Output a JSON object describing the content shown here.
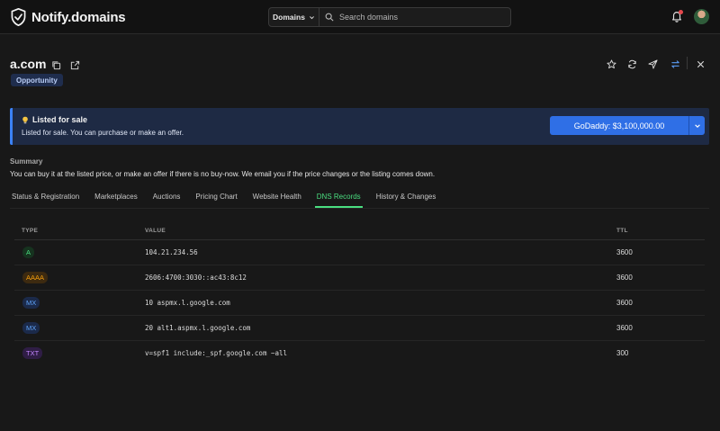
{
  "app": {
    "name": "Notify.domains"
  },
  "search": {
    "scope": "Domains",
    "placeholder": "Search domains"
  },
  "domain": {
    "name": "a.com",
    "badge": "Opportunity"
  },
  "banner": {
    "icon": "lightbulb-icon",
    "title": "Listed for sale",
    "text": "Listed for sale. You can purchase or make an offer.",
    "button_label": "GoDaddy: $3,100,000.00"
  },
  "summary": {
    "label": "Summary",
    "text": "You can buy it at the listed price, or make an offer if there is no buy-now. We email you if the price changes or the listing comes down."
  },
  "tabs": [
    {
      "label": "Status & Registration",
      "active": false
    },
    {
      "label": "Marketplaces",
      "active": false
    },
    {
      "label": "Auctions",
      "active": false
    },
    {
      "label": "Pricing Chart",
      "active": false
    },
    {
      "label": "Website Health",
      "active": false
    },
    {
      "label": "DNS Records",
      "active": true
    },
    {
      "label": "History & Changes",
      "active": false
    }
  ],
  "dns": {
    "headers": {
      "type": "TYPE",
      "value": "VALUE",
      "ttl": "TTL"
    },
    "rows": [
      {
        "type": "A",
        "value": "104.21.234.56",
        "ttl": "3600"
      },
      {
        "type": "AAAA",
        "value": "2606:4700:3030::ac43:8c12",
        "ttl": "3600"
      },
      {
        "type": "MX",
        "value": "10 aspmx.l.google.com",
        "ttl": "3600"
      },
      {
        "type": "MX",
        "value": "20 alt1.aspmx.l.google.com",
        "ttl": "3600"
      },
      {
        "type": "TXT",
        "value": "v=spf1 include:_spf.google.com ~all",
        "ttl": "300"
      }
    ]
  },
  "colors": {
    "accent_green": "#4ade80",
    "primary_blue": "#2f6fe6",
    "type_A": "#4ade80",
    "type_AAAA": "#f59e0b",
    "type_MX": "#60a5fa",
    "type_TXT": "#c084fc"
  }
}
